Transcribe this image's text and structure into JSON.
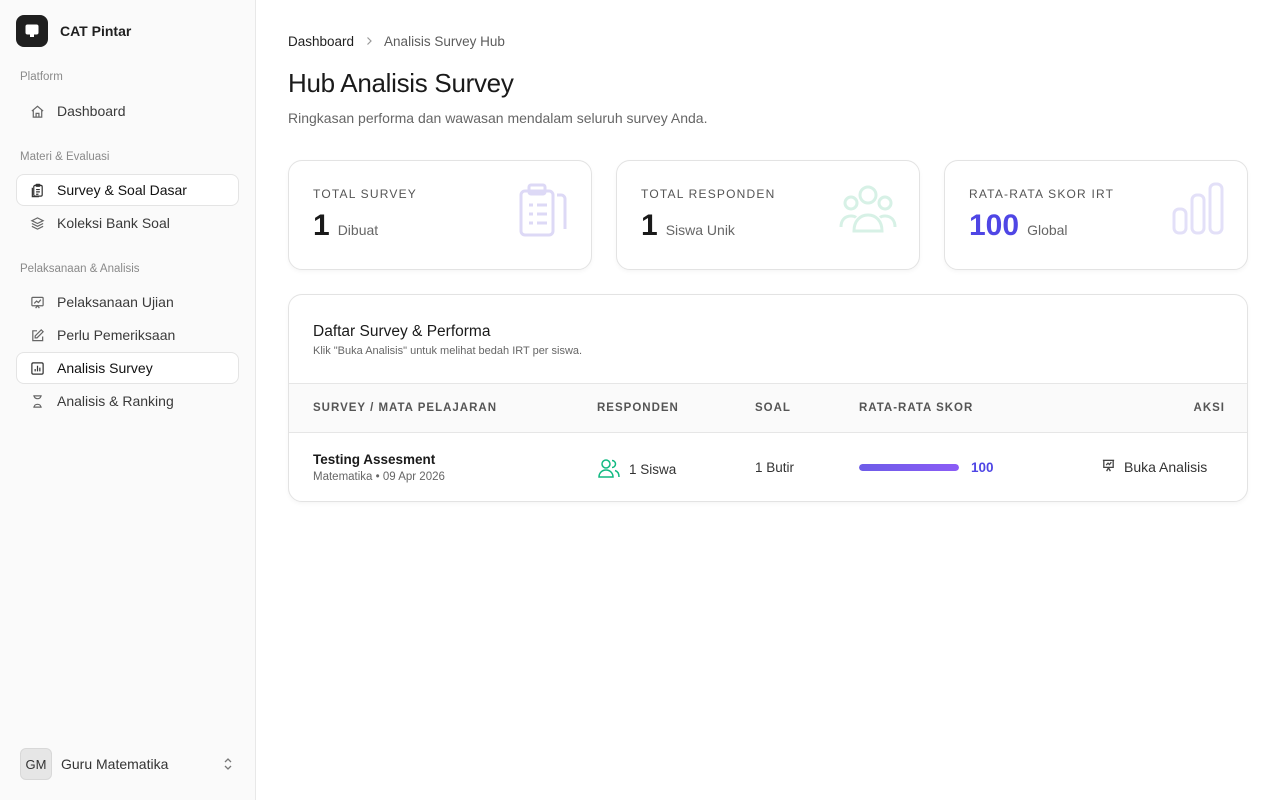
{
  "sidebar": {
    "brand": "CAT Pintar",
    "sections": [
      {
        "label": "Platform"
      },
      {
        "label": "Materi & Evaluasi"
      },
      {
        "label": "Pelaksanaan & Analisis"
      }
    ],
    "items": [
      {
        "label": "Dashboard",
        "icon": "home-icon"
      },
      {
        "label": "Survey & Soal Dasar",
        "icon": "clipboard-copy-icon"
      },
      {
        "label": "Koleksi Bank Soal",
        "icon": "layers-icon"
      },
      {
        "label": "Pelaksanaan Ujian",
        "icon": "presentation-chart-icon"
      },
      {
        "label": "Perlu Pemeriksaan",
        "icon": "pencil-square-icon"
      },
      {
        "label": "Analisis Survey",
        "icon": "bar-chart-icon"
      },
      {
        "label": "Analisis & Ranking",
        "icon": "hourglass-icon"
      }
    ],
    "user": {
      "initials": "GM",
      "name": "Guru Matematika"
    }
  },
  "breadcrumb": [
    "Dashboard",
    "Analisis Survey Hub"
  ],
  "page": {
    "title": "Hub Analisis Survey",
    "subtitle": "Ringkasan performa dan wawasan mendalam seluruh survey Anda."
  },
  "stats": [
    {
      "label": "TOTAL SURVEY",
      "value": "1",
      "unit": "Dibuat",
      "icon": "clipboard-list-icon"
    },
    {
      "label": "TOTAL RESPONDEN",
      "value": "1",
      "unit": "Siswa Unik",
      "icon": "users-group-icon"
    },
    {
      "label": "RATA-RATA SKOR IRT",
      "value": "100",
      "unit": "Global",
      "icon": "bar-chart-icon",
      "accent": "#4f46e5"
    }
  ],
  "table": {
    "title": "Daftar Survey & Performa",
    "subtitle": "Klik \"Buka Analisis\" untuk melihat bedah IRT per siswa.",
    "headers": [
      "SURVEY / MATA PELAJARAN",
      "RESPONDEN",
      "SOAL",
      "RATA-RATA SKOR",
      "AKSI"
    ],
    "rows": [
      {
        "title": "Testing Assesment",
        "meta": "Matematika • 09 Apr 2026",
        "responden": "1 Siswa",
        "soal": "1 Butir",
        "score": "100",
        "score_fraction": 1.0,
        "action": "Buka Analisis"
      }
    ]
  },
  "colors": {
    "accent": "#4f46e5",
    "teal": "#10b981"
  }
}
